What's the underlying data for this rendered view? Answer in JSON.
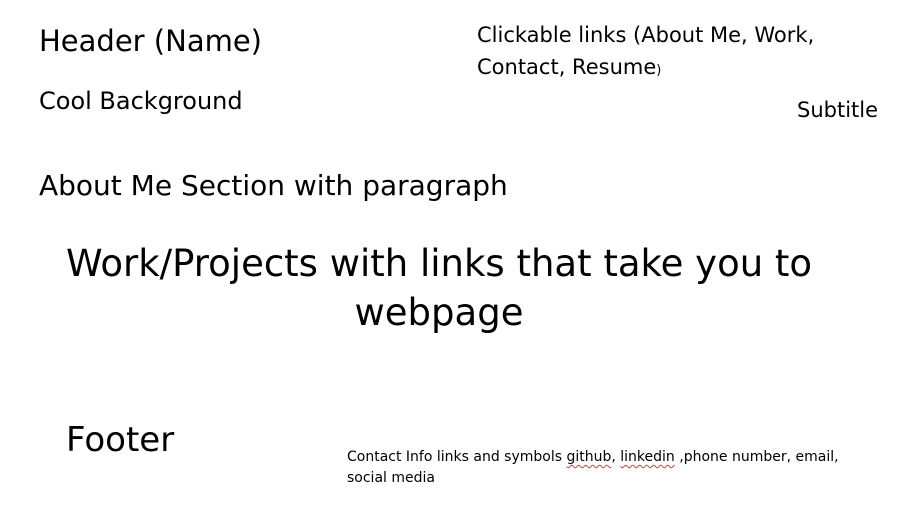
{
  "header": {
    "name_placeholder": "Header (Name)",
    "background_note": "Cool Background",
    "subtitle": "Subtitle"
  },
  "nav": {
    "text": "Clickable links (About Me, Work, Contact, Resume",
    "close_paren": ")"
  },
  "about": {
    "text": "About Me Section with paragraph"
  },
  "work": {
    "text": "Work/Projects with links that take you to webpage"
  },
  "footer": {
    "label": "Footer",
    "contact_prefix": "Contact Info  links and symbols ",
    "github": "github",
    "comma_space": ", ",
    "linkedin": "linkedin",
    "contact_suffix": " ,phone number, email, social media"
  },
  "colors": {
    "background": "#ffffff",
    "text": "#000000",
    "spellcheck_underline": "#d63c3c"
  }
}
